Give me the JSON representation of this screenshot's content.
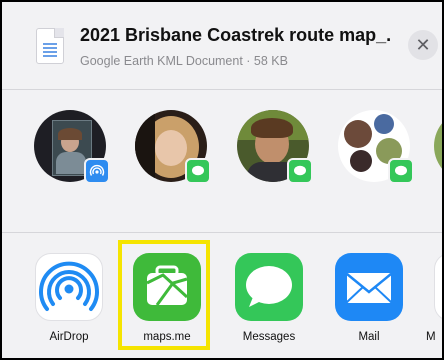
{
  "header": {
    "title": "2021 Brisbane Coastrek route map_...",
    "subtitle": "Google Earth KML Document · 58 KB",
    "close_icon": "close-icon"
  },
  "people": [
    {
      "name": "contact-1",
      "badge": "airdrop"
    },
    {
      "name": "contact-2",
      "badge": "messages"
    },
    {
      "name": "contact-3",
      "badge": "messages"
    },
    {
      "name": "contact-4",
      "badge": "messages"
    },
    {
      "name": "contact-5",
      "badge": "none"
    }
  ],
  "apps": [
    {
      "label": "AirDrop",
      "icon": "airdrop-icon"
    },
    {
      "label": "maps.me",
      "icon": "maps-me-icon"
    },
    {
      "label": "Messages",
      "icon": "messages-icon"
    },
    {
      "label": "Mail",
      "icon": "mail-icon"
    },
    {
      "label": "M",
      "icon": "partial-app-icon"
    }
  ],
  "colors": {
    "highlight": "#f5e400",
    "messages_green": "#34c759",
    "mail_blue": "#1e88f5",
    "mapsme_green": "#3fba3a"
  }
}
